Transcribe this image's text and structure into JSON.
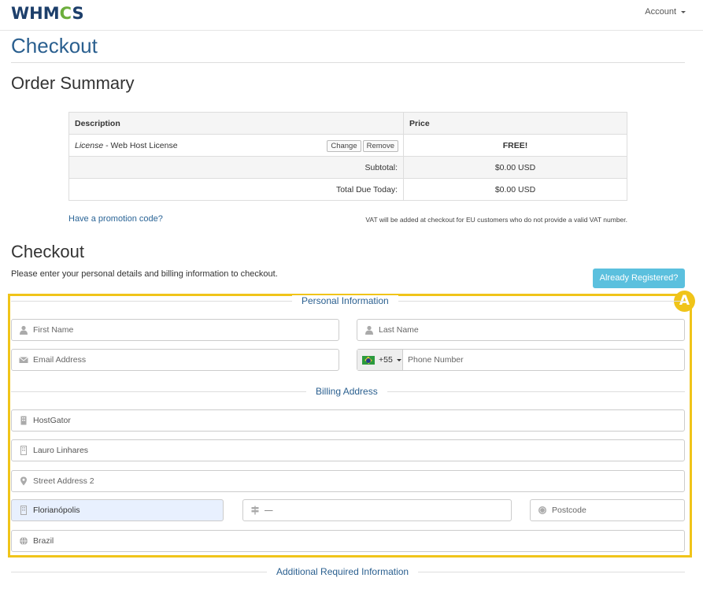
{
  "header": {
    "logo_text": "WHM",
    "logo_gear": "C",
    "logo_end": "S",
    "account_label": "Account"
  },
  "page_title": "Checkout",
  "order_summary": {
    "heading": "Order Summary",
    "columns": [
      "Description",
      "Price"
    ],
    "item": {
      "name_italic": "License",
      "name_rest": " - Web Host License",
      "change_label": "Change",
      "remove_label": "Remove",
      "price": "FREE!"
    },
    "subtotal_label": "Subtotal:",
    "subtotal_value": "$0.00 USD",
    "total_label": "Total Due Today:",
    "total_value": "$0.00 USD",
    "promo_link": "Have a promotion code?",
    "vat_note": "VAT will be added at checkout for EU customers who do not provide a valid VAT number."
  },
  "checkout": {
    "heading": "Checkout",
    "intro": "Please enter your personal details and billing information to checkout.",
    "already_registered": "Already Registered?",
    "annotation_badge": "A"
  },
  "personal_info": {
    "label": "Personal Information",
    "first_name_placeholder": "First Name",
    "last_name_placeholder": "Last Name",
    "email_placeholder": "Email Address",
    "phone_code": "+55",
    "phone_placeholder": "Phone Number"
  },
  "billing": {
    "label": "Billing Address",
    "company": "HostGator",
    "address1": "Lauro Linhares",
    "address2_placeholder": "Street Address 2",
    "city": "Florianópolis",
    "state": "—",
    "postcode_placeholder": "Postcode",
    "country": "Brazil"
  },
  "additional": {
    "label": "Additional Required Information"
  },
  "colors": {
    "accent": "#2a5f8f",
    "highlight": "#f0c419",
    "info_button": "#5bc0de"
  }
}
